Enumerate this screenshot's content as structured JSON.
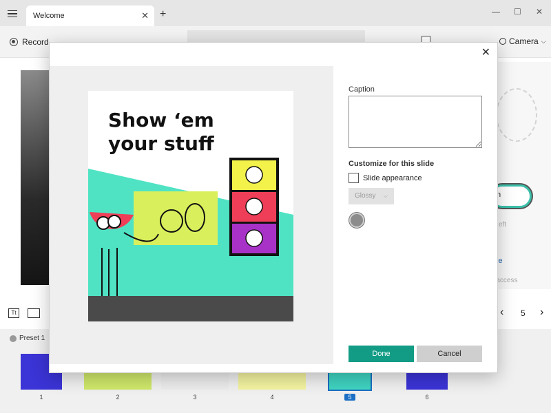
{
  "window": {
    "tab_title": "Welcome",
    "tab_close": "✕",
    "new_tab": "+",
    "minimize": "—",
    "maximize": "☐",
    "close": "✕"
  },
  "toolbar": {
    "record_label": "Record",
    "camera_label": "Camera",
    "camera_chevron": "⌵"
  },
  "bottom_tools": {
    "text_tool_glyph": "Tt"
  },
  "pager": {
    "prev": "‹",
    "page": "5",
    "next": "›"
  },
  "filmstrip": {
    "preset_label": "Preset 1",
    "thumbnails": [
      {
        "number": "1",
        "color": "#3b34d6",
        "active": false
      },
      {
        "number": "2",
        "color": "#cfe86a",
        "active": false
      },
      {
        "number": "3",
        "color": "#ececec",
        "active": false
      },
      {
        "number": "4",
        "color": "#f3f3a0",
        "active": false
      },
      {
        "number": "5",
        "color": "#3fd3c0",
        "active": true
      },
      {
        "number": "6",
        "color": "#3b34d6",
        "active": false
      }
    ]
  },
  "background_right_panel": {
    "fragment_1": "n",
    "fragment_2": "eft",
    "link_fragment": "se",
    "fragment_3": "d access"
  },
  "modal": {
    "close_glyph": "✕",
    "slide": {
      "title_line1": "Show ‘em",
      "title_line2": "your stuff",
      "colors": {
        "teal": "#4fe3c4",
        "lime": "#d9ef5c",
        "red": "#ef3e57",
        "purple": "#a832c8",
        "yellow": "#f2f24a",
        "dark_floor": "#4a4a4a"
      }
    },
    "caption_label": "Caption",
    "caption_value": "",
    "customize_heading": "Customize for this slide",
    "slide_appearance_label": "Slide appearance",
    "slide_appearance_checked": false,
    "appearance_style": "Glossy",
    "swatch_color": "#8c8c8c",
    "done_label": "Done",
    "cancel_label": "Cancel",
    "accent": "#129c85"
  }
}
